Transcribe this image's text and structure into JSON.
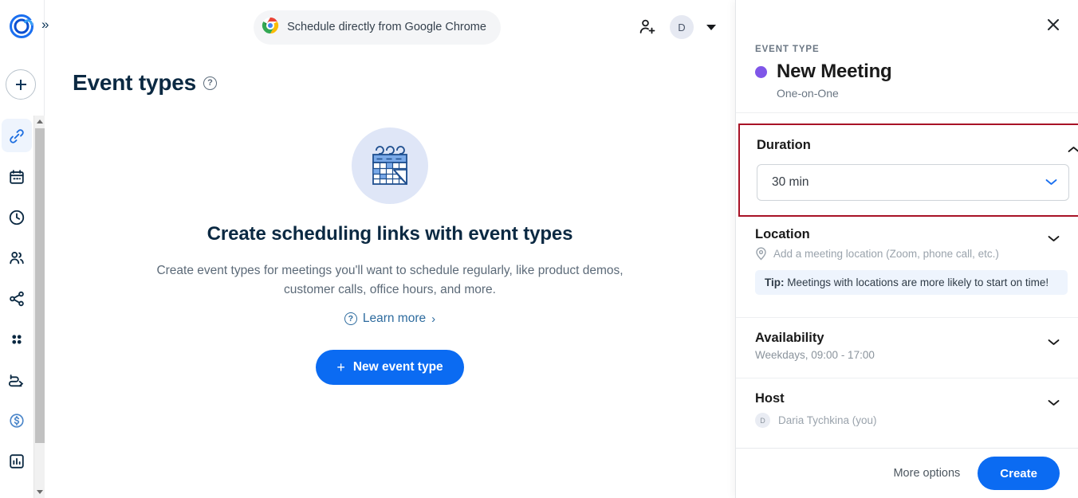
{
  "sidebar": {
    "logo_name": "calendly-logo",
    "expand_label": "»",
    "create_button_label": "+",
    "items": [
      {
        "icon": "link-icon",
        "name": "event-types",
        "active": true
      },
      {
        "icon": "calendar-icon",
        "name": "scheduled-events",
        "active": false
      },
      {
        "icon": "clock-icon",
        "name": "availability",
        "active": false
      },
      {
        "icon": "people-icon",
        "name": "meeting-polls",
        "active": false
      },
      {
        "icon": "share-icon",
        "name": "routing",
        "active": false
      },
      {
        "icon": "apps-grid-icon",
        "name": "integrations",
        "active": false
      },
      {
        "icon": "workflows-icon",
        "name": "workflows",
        "active": false
      },
      {
        "icon": "dollar-icon",
        "name": "payments",
        "active": false
      },
      {
        "icon": "chart-icon",
        "name": "analytics",
        "active": false
      }
    ]
  },
  "topbar": {
    "chrome_banner": "Schedule directly from Google Chrome",
    "chrome_icon": "google-chrome-icon",
    "invite_icon": "add-user-icon",
    "avatar_initial": "D",
    "caret_icon": "caret-down-icon"
  },
  "main": {
    "page_title": "Event types",
    "help_icon_label": "?",
    "illustration": "calendar-illustration",
    "empty_heading": "Create scheduling links with event types",
    "empty_description": "Create event types for meetings you'll want to schedule regularly, like product demos, customer calls, office hours, and more.",
    "learn_more_label": "Learn more",
    "learn_more_arrow": "›",
    "new_event_button": "New event type",
    "new_event_plus": "+"
  },
  "panel": {
    "close_icon": "close-icon",
    "kicker": "EVENT TYPE",
    "event_title": "New Meeting",
    "event_dot_color": "#7f56e8",
    "event_subtitle": "One-on-One",
    "highlight_color": "#a81226",
    "duration": {
      "title": "Duration",
      "chevron": "chevron-up-icon",
      "selected_value": "30 min",
      "dropdown_chevron": "chevron-down-icon"
    },
    "location": {
      "title": "Location",
      "chevron": "chevron-down-icon",
      "pin_icon": "map-pin-icon",
      "placeholder": "Add a meeting location (Zoom, phone call, etc.)",
      "tip_label": "Tip:",
      "tip_text": " Meetings with locations are more likely to start on time!"
    },
    "availability": {
      "title": "Availability",
      "chevron": "chevron-down-icon",
      "value": "Weekdays, 09:00 - 17:00"
    },
    "host": {
      "title": "Host",
      "chevron": "chevron-down-icon",
      "avatar_initial": "D",
      "name": "Daria Tychkina (you)"
    },
    "footer": {
      "more_options_label": "More options",
      "create_label": "Create",
      "create_color": "#0b6bf2"
    }
  }
}
